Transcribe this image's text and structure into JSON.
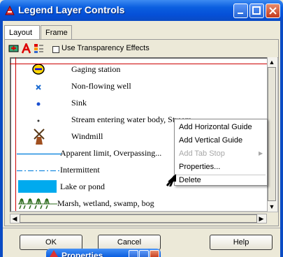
{
  "window": {
    "title": "Legend Layer Controls"
  },
  "tabs": [
    {
      "label": "Layout"
    },
    {
      "label": "Frame"
    }
  ],
  "toolbar": {
    "transparency_label": "Use Transparency Effects"
  },
  "legend_items": [
    {
      "label": "Gaging station",
      "symbol": "gaging-station-icon"
    },
    {
      "label": "Non-flowing well",
      "symbol": "x-mark-icon"
    },
    {
      "label": "Sink",
      "symbol": "dot-icon"
    },
    {
      "label": "Stream entering water body, Stream",
      "symbol": "small-dot-icon"
    },
    {
      "label": "Windmill",
      "symbol": "windmill-icon"
    },
    {
      "label": "Apparent limit, Overpassing...",
      "symbol": "solid-line-icon"
    },
    {
      "label": "Intermittent",
      "symbol": "dash-dot-line-icon"
    },
    {
      "label": "Lake or pond",
      "symbol": "lake-swatch-icon"
    },
    {
      "label": "Marsh, wetland, swamp, bog",
      "symbol": "marsh-pattern-icon"
    }
  ],
  "context_menu": {
    "items": [
      {
        "label": "Add Horizontal Guide",
        "enabled": true
      },
      {
        "label": "Add Vertical Guide",
        "enabled": true
      },
      {
        "label": "Add Tab Stop",
        "enabled": false
      },
      {
        "label": "Properties...",
        "enabled": true
      },
      {
        "label": "Delete",
        "enabled": true
      }
    ]
  },
  "buttons": {
    "ok": "OK",
    "cancel": "Cancel",
    "help": "Help"
  },
  "popup": {
    "title": "Properties"
  },
  "colors": {
    "titlebar": "#0550d8",
    "guide_red": "#cc0000",
    "lake_blue": "#00aaee",
    "line_blue": "#1a8ce0"
  }
}
